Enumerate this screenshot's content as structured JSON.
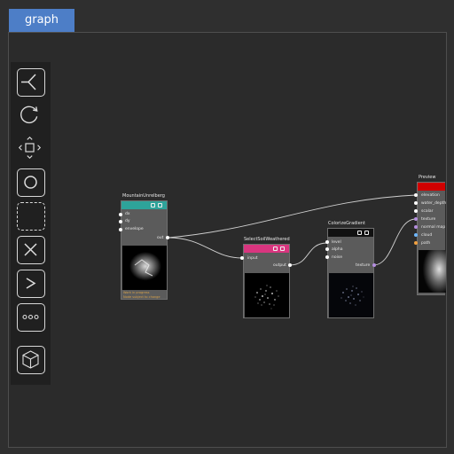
{
  "tab": {
    "label": "graph"
  },
  "toolbar": {
    "items": [
      {
        "icon": "split-icon"
      },
      {
        "icon": "rotate-icon"
      },
      {
        "icon": "move-arrows-icon"
      },
      {
        "icon": "circle-icon"
      },
      {
        "icon": "dashed-square-icon"
      },
      {
        "icon": "x-icon"
      },
      {
        "icon": "chevron-right-icon"
      },
      {
        "icon": "more-dots-icon"
      },
      {
        "icon": "cube-icon"
      }
    ]
  },
  "nodes": {
    "mountain": {
      "title": "MountainUnrelberg",
      "header_color": "#2ea39a",
      "inputs": [
        "dx",
        "dy",
        "envelope"
      ],
      "output": "out",
      "status_line1": "Work in progress",
      "status_line2": "Node subject to change"
    },
    "select": {
      "title": "SelectSoilWeathered",
      "header_color": "#d9357f",
      "input": "input",
      "output": "output"
    },
    "colorize": {
      "title": "ColorizeGradient",
      "header_color": "#111111",
      "inputs": [
        "level",
        "alpha",
        "noise"
      ],
      "output": "texture"
    },
    "preview": {
      "title": "Preview",
      "header_color": "#d10000",
      "inputs": [
        "elevation",
        "water_depth",
        "scalar",
        "texture",
        "normal map",
        "cloud",
        "path"
      ],
      "input_colors": [
        "#ffffff",
        "#ffffff",
        "#ffffff",
        "#b58ee0",
        "#b58ee0",
        "#6fb8ff",
        "#f0a040"
      ]
    }
  }
}
